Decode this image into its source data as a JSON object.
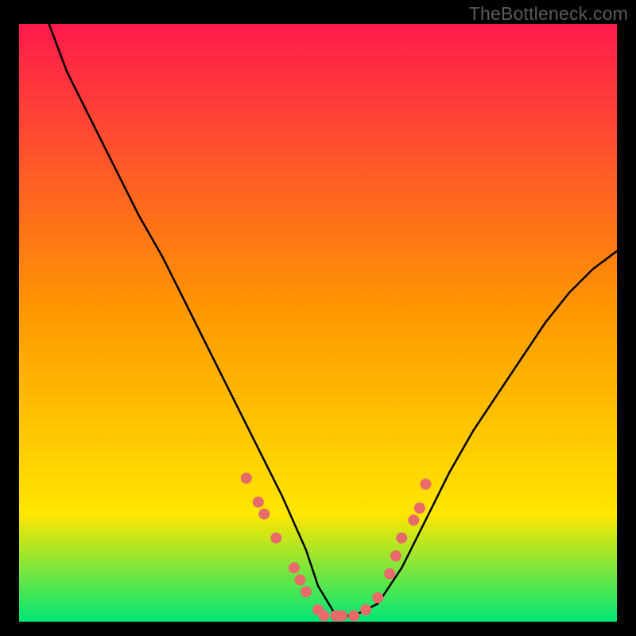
{
  "watermark": "TheBottleneck.com",
  "chart_data": {
    "type": "line",
    "title": "",
    "xlabel": "",
    "ylabel": "",
    "xlim": [
      0,
      100
    ],
    "ylim": [
      0,
      100
    ],
    "gradient_colors": [
      "#ff1a4d",
      "#ff9a00",
      "#ffe600",
      "#00e676"
    ],
    "series": [
      {
        "name": "curve",
        "color": "#000000",
        "x": [
          5,
          8,
          12,
          16,
          20,
          24,
          28,
          32,
          36,
          40,
          44,
          48,
          50,
          53,
          56,
          60,
          64,
          68,
          72,
          76,
          80,
          84,
          88,
          92,
          96,
          100
        ],
        "y": [
          100,
          92,
          84,
          76,
          68,
          61,
          53,
          45,
          37,
          29,
          21,
          12,
          6,
          1,
          1,
          3,
          9,
          17,
          25,
          32,
          38,
          44,
          50,
          55,
          59,
          62
        ]
      }
    ],
    "marker_points": {
      "name": "markers",
      "color": "#e86a6a",
      "x": [
        38,
        40,
        41,
        43,
        46,
        47,
        48,
        50,
        51,
        53,
        54,
        56,
        58,
        60,
        62,
        63,
        64,
        66,
        67,
        68
      ],
      "y": [
        24,
        20,
        18,
        14,
        9,
        7,
        5,
        2,
        1,
        1,
        1,
        1,
        2,
        4,
        8,
        11,
        14,
        17,
        19,
        23
      ]
    }
  }
}
